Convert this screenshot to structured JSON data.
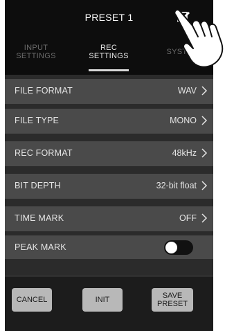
{
  "header": {
    "title": "PRESET 1"
  },
  "tabs": [
    {
      "label": "INPUT\nSETTINGS",
      "active": false
    },
    {
      "label": "REC\nSETTINGS",
      "active": true
    },
    {
      "label": "SYSTEM",
      "active": false
    }
  ],
  "rows": [
    {
      "label": "FILE FORMAT",
      "value": "WAV"
    },
    {
      "label": "FILE TYPE",
      "value": "MONO"
    },
    {
      "label": "REC FORMAT",
      "value": "48kHz"
    },
    {
      "label": "BIT DEPTH",
      "value": "32-bit float"
    },
    {
      "label": "TIME MARK",
      "value": "OFF"
    },
    {
      "label": "PEAK MARK",
      "toggle": false
    }
  ],
  "footer": {
    "cancel": "CANCEL",
    "init": "INIT",
    "save_line1": "SAVE",
    "save_line2": "PRESET"
  },
  "colors": {
    "header_bg": "#0d0d0d",
    "row_bg": "#4a4a4a",
    "button_bg": "#b8b8b8",
    "page_bg": "#2b2b2b"
  },
  "icons": {
    "edit": "edit-icon",
    "chevron": "chevron-right-icon"
  }
}
